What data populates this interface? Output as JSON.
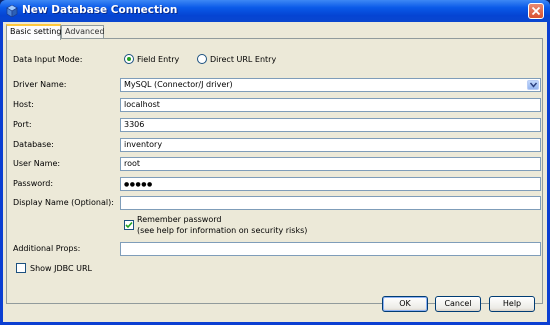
{
  "window": {
    "title": "New Database Connection"
  },
  "tabs": [
    {
      "label": "Basic setting",
      "active": true
    },
    {
      "label": "Advanced",
      "active": false
    }
  ],
  "form": {
    "data_input_mode": {
      "label": "Data Input Mode:",
      "options": [
        {
          "label": "Field Entry",
          "selected": true
        },
        {
          "label": "Direct URL Entry",
          "selected": false
        }
      ]
    },
    "driver_name": {
      "label": "Driver Name:",
      "value": "MySQL (Connector/J driver)"
    },
    "host": {
      "label": "Host:",
      "value": "localhost"
    },
    "port": {
      "label": "Port:",
      "value": "3306"
    },
    "database": {
      "label": "Database:",
      "value": "inventory"
    },
    "user_name": {
      "label": "User Name:",
      "value": "root"
    },
    "password": {
      "label": "Password:",
      "value": "●●●●●"
    },
    "display_name": {
      "label": "Display Name (Optional):",
      "value": ""
    },
    "remember_password": {
      "label": "Remember password",
      "hint": "(see help for information on security risks)",
      "checked": true
    },
    "additional_props": {
      "label": "Additional Props:",
      "value": ""
    },
    "show_jdbc_url": {
      "label": "Show JDBC URL",
      "checked": false
    }
  },
  "buttons": {
    "ok": "OK",
    "cancel": "Cancel",
    "help": "Help"
  },
  "colors": {
    "titlebar": "#0a5ae8",
    "background": "#ece9d8",
    "radio_dot": "#21a121"
  }
}
